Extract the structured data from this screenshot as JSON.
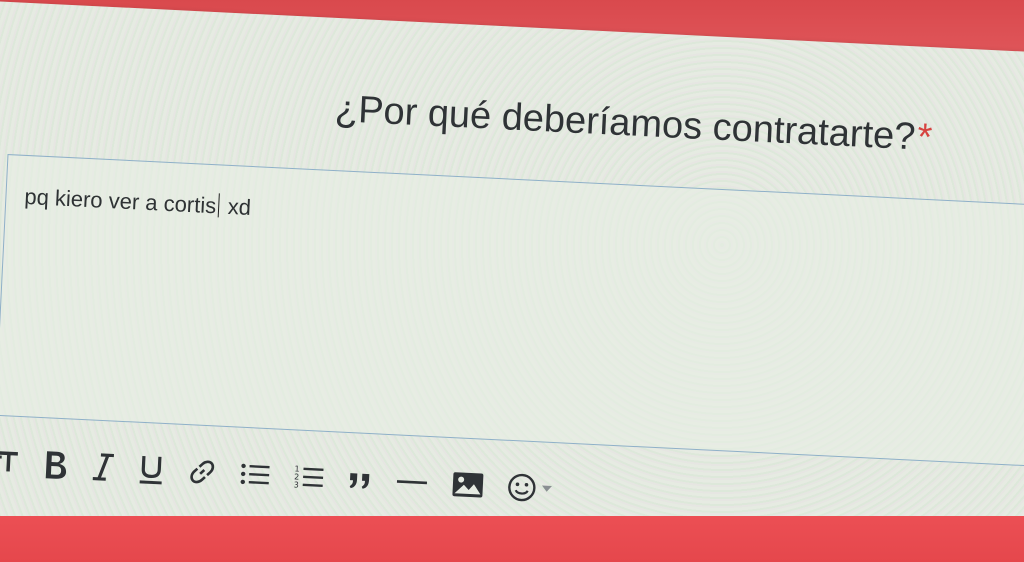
{
  "question": {
    "label": "¿Por qué deberíamos contratarte?",
    "required_mark": "*"
  },
  "answer": {
    "text_before_caret": "pq kiero ver a cortis",
    "text_after_caret": " xd"
  },
  "toolbar": {
    "items": [
      {
        "name": "text-size-icon"
      },
      {
        "name": "bold-icon"
      },
      {
        "name": "italic-icon"
      },
      {
        "name": "underline-icon"
      },
      {
        "name": "link-icon"
      },
      {
        "name": "bullet-list-icon"
      },
      {
        "name": "numbered-list-icon"
      },
      {
        "name": "quote-icon"
      },
      {
        "name": "horizontal-rule-icon"
      },
      {
        "name": "image-icon"
      },
      {
        "name": "emoji-icon"
      }
    ]
  },
  "colors": {
    "background_red": "#e2474c",
    "card": "#e6ebe2",
    "required_red": "#d6433f",
    "border_blue": "#8fb0c8",
    "text": "#2f3336"
  }
}
